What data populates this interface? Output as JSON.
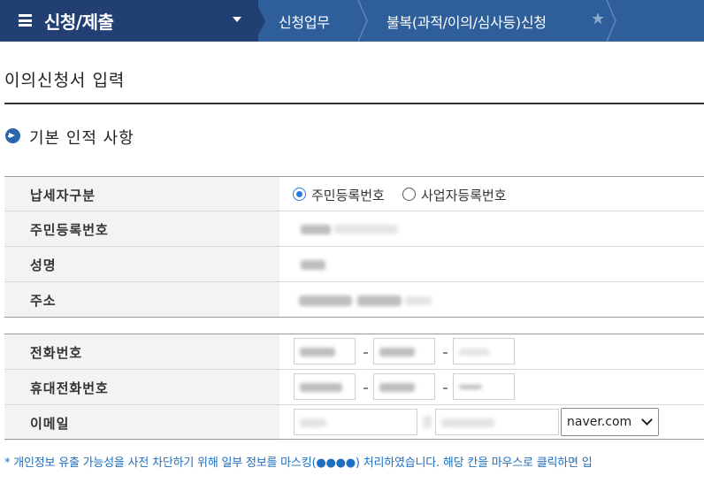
{
  "nav": {
    "menu_title": "신청/제출",
    "breadcrumbs": [
      "신청업무",
      "불복(과적/이의/심사등)신청"
    ],
    "colors": {
      "menu_bg": "#223f74",
      "bar_bg": "#2e5f9a"
    }
  },
  "page": {
    "title": "이의신청서 입력"
  },
  "section": {
    "title": "기본 인적 사항"
  },
  "form": {
    "taxpayer_type": {
      "label": "납세자구분",
      "options": [
        "주민등록번호",
        "사업자등록번호"
      ],
      "selected": "주민등록번호"
    },
    "rrn": {
      "label": "주민등록번호"
    },
    "name": {
      "label": "성명"
    },
    "address": {
      "label": "주소"
    },
    "phone": {
      "label": "전화번호"
    },
    "mobile": {
      "label": "휴대전화번호"
    },
    "email": {
      "label": "이메일",
      "domain_selected": "naver.com"
    }
  },
  "notice": "* 개인정보 유출 가능성을 사전 차단하기 위해 일부 정보를 마스킹(●●●●) 처리하였습니다. 해당 칸을 마우스로 클릭하면 입"
}
